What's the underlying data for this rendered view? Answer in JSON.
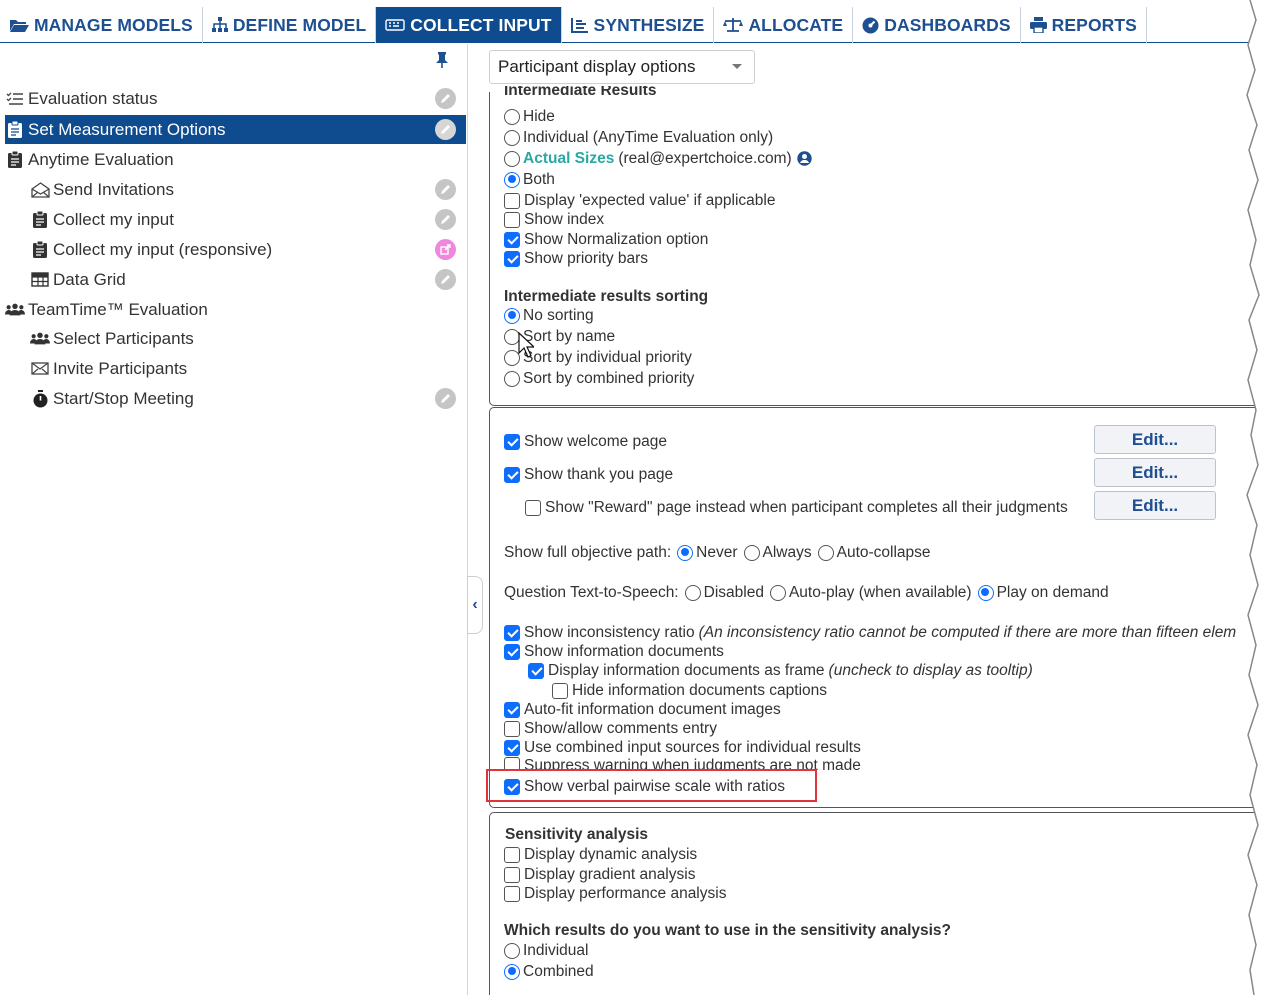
{
  "nav": {
    "tabs": [
      {
        "label": "MANAGE MODELS",
        "icon": "folder-open-icon"
      },
      {
        "label": "DEFINE MODEL",
        "icon": "sitemap-icon"
      },
      {
        "label": "COLLECT INPUT",
        "icon": "keyboard-icon",
        "active": true
      },
      {
        "label": "SYNTHESIZE",
        "icon": "chart-icon"
      },
      {
        "label": "ALLOCATE",
        "icon": "balance-scale-icon"
      },
      {
        "label": "DASHBOARDS",
        "icon": "dashboard-icon"
      },
      {
        "label": "REPORTS",
        "icon": "print-icon"
      }
    ]
  },
  "sidebar": {
    "items": [
      {
        "label": "Evaluation status",
        "icon": "list-check-icon"
      },
      {
        "label": "Set Measurement Options",
        "icon": "clipboard-icon",
        "selected": true
      },
      {
        "label": "Anytime Evaluation",
        "icon": "clipboard-icon"
      },
      {
        "label": "Send Invitations",
        "icon": "envelope-open-icon"
      },
      {
        "label": "Collect my input",
        "icon": "clipboard-icon"
      },
      {
        "label": "Collect my input (responsive)",
        "icon": "clipboard-icon"
      },
      {
        "label": "Data Grid",
        "icon": "table-icon"
      },
      {
        "label": "TeamTime™ Evaluation",
        "icon": "users-icon"
      },
      {
        "label": "Select Participants",
        "icon": "users-icon"
      },
      {
        "label": "Invite Participants",
        "icon": "envelope-icon"
      },
      {
        "label": "Start/Stop Meeting",
        "icon": "stopwatch-icon"
      }
    ]
  },
  "options_select": {
    "value": "Participant display options"
  },
  "intermediate": {
    "heading": "Intermediate Results",
    "hide": "Hide",
    "individual": "Individual (AnyTime Evaluation only)",
    "actual_sizes": "Actual Sizes",
    "actual_sizes_user": "(real@expertchoice.com)",
    "both": "Both",
    "expected_value": "Display 'expected value' if applicable",
    "show_index": "Show index",
    "normalization": "Show Normalization option",
    "priority_bars": "Show priority bars"
  },
  "sorting": {
    "heading": "Intermediate results sorting",
    "no_sorting": "No sorting",
    "by_name": "Sort by name",
    "by_individual": "Sort by individual priority",
    "by_combined": "Sort by combined priority"
  },
  "pages": {
    "welcome": "Show welcome page",
    "thank_you": "Show thank you page",
    "reward": "Show \"Reward\" page instead when participant completes all their judgments",
    "edit_label": "Edit..."
  },
  "objective_path": {
    "label": "Show full objective path:",
    "never": "Never",
    "always": "Always",
    "auto": "Auto-collapse"
  },
  "tts": {
    "label": "Question Text-to-Speech:",
    "disabled": "Disabled",
    "autoplay": "Auto-play (when available)",
    "on_demand": "Play on demand"
  },
  "display": {
    "inconsistency": "Show inconsistency ratio",
    "inconsistency_note": "(An inconsistency ratio cannot be computed if there are more than fifteen elem",
    "info_docs": "Show information documents",
    "info_frame": "Display information documents as frame",
    "info_frame_note": "(uncheck to display as tooltip)",
    "hide_captions": "Hide information documents captions",
    "autofit": "Auto-fit information document images",
    "comments": "Show/allow comments entry",
    "combined_sources": "Use combined input sources for individual results",
    "suppress_warning": "Suppress warning when judgments are not made",
    "verbal_scale": "Show verbal pairwise scale with ratios"
  },
  "sensitivity": {
    "heading": "Sensitivity analysis",
    "dynamic": "Display dynamic analysis",
    "gradient": "Display gradient analysis",
    "performance": "Display performance analysis",
    "which_heading": "Which results do you want to use in the sensitivity analysis?",
    "individual": "Individual",
    "combined": "Combined"
  },
  "colors": {
    "nav_active": "#0e4b8f",
    "accent": "#2aa8a2",
    "check": "#0d6efd",
    "highlight": "#e2323a"
  }
}
